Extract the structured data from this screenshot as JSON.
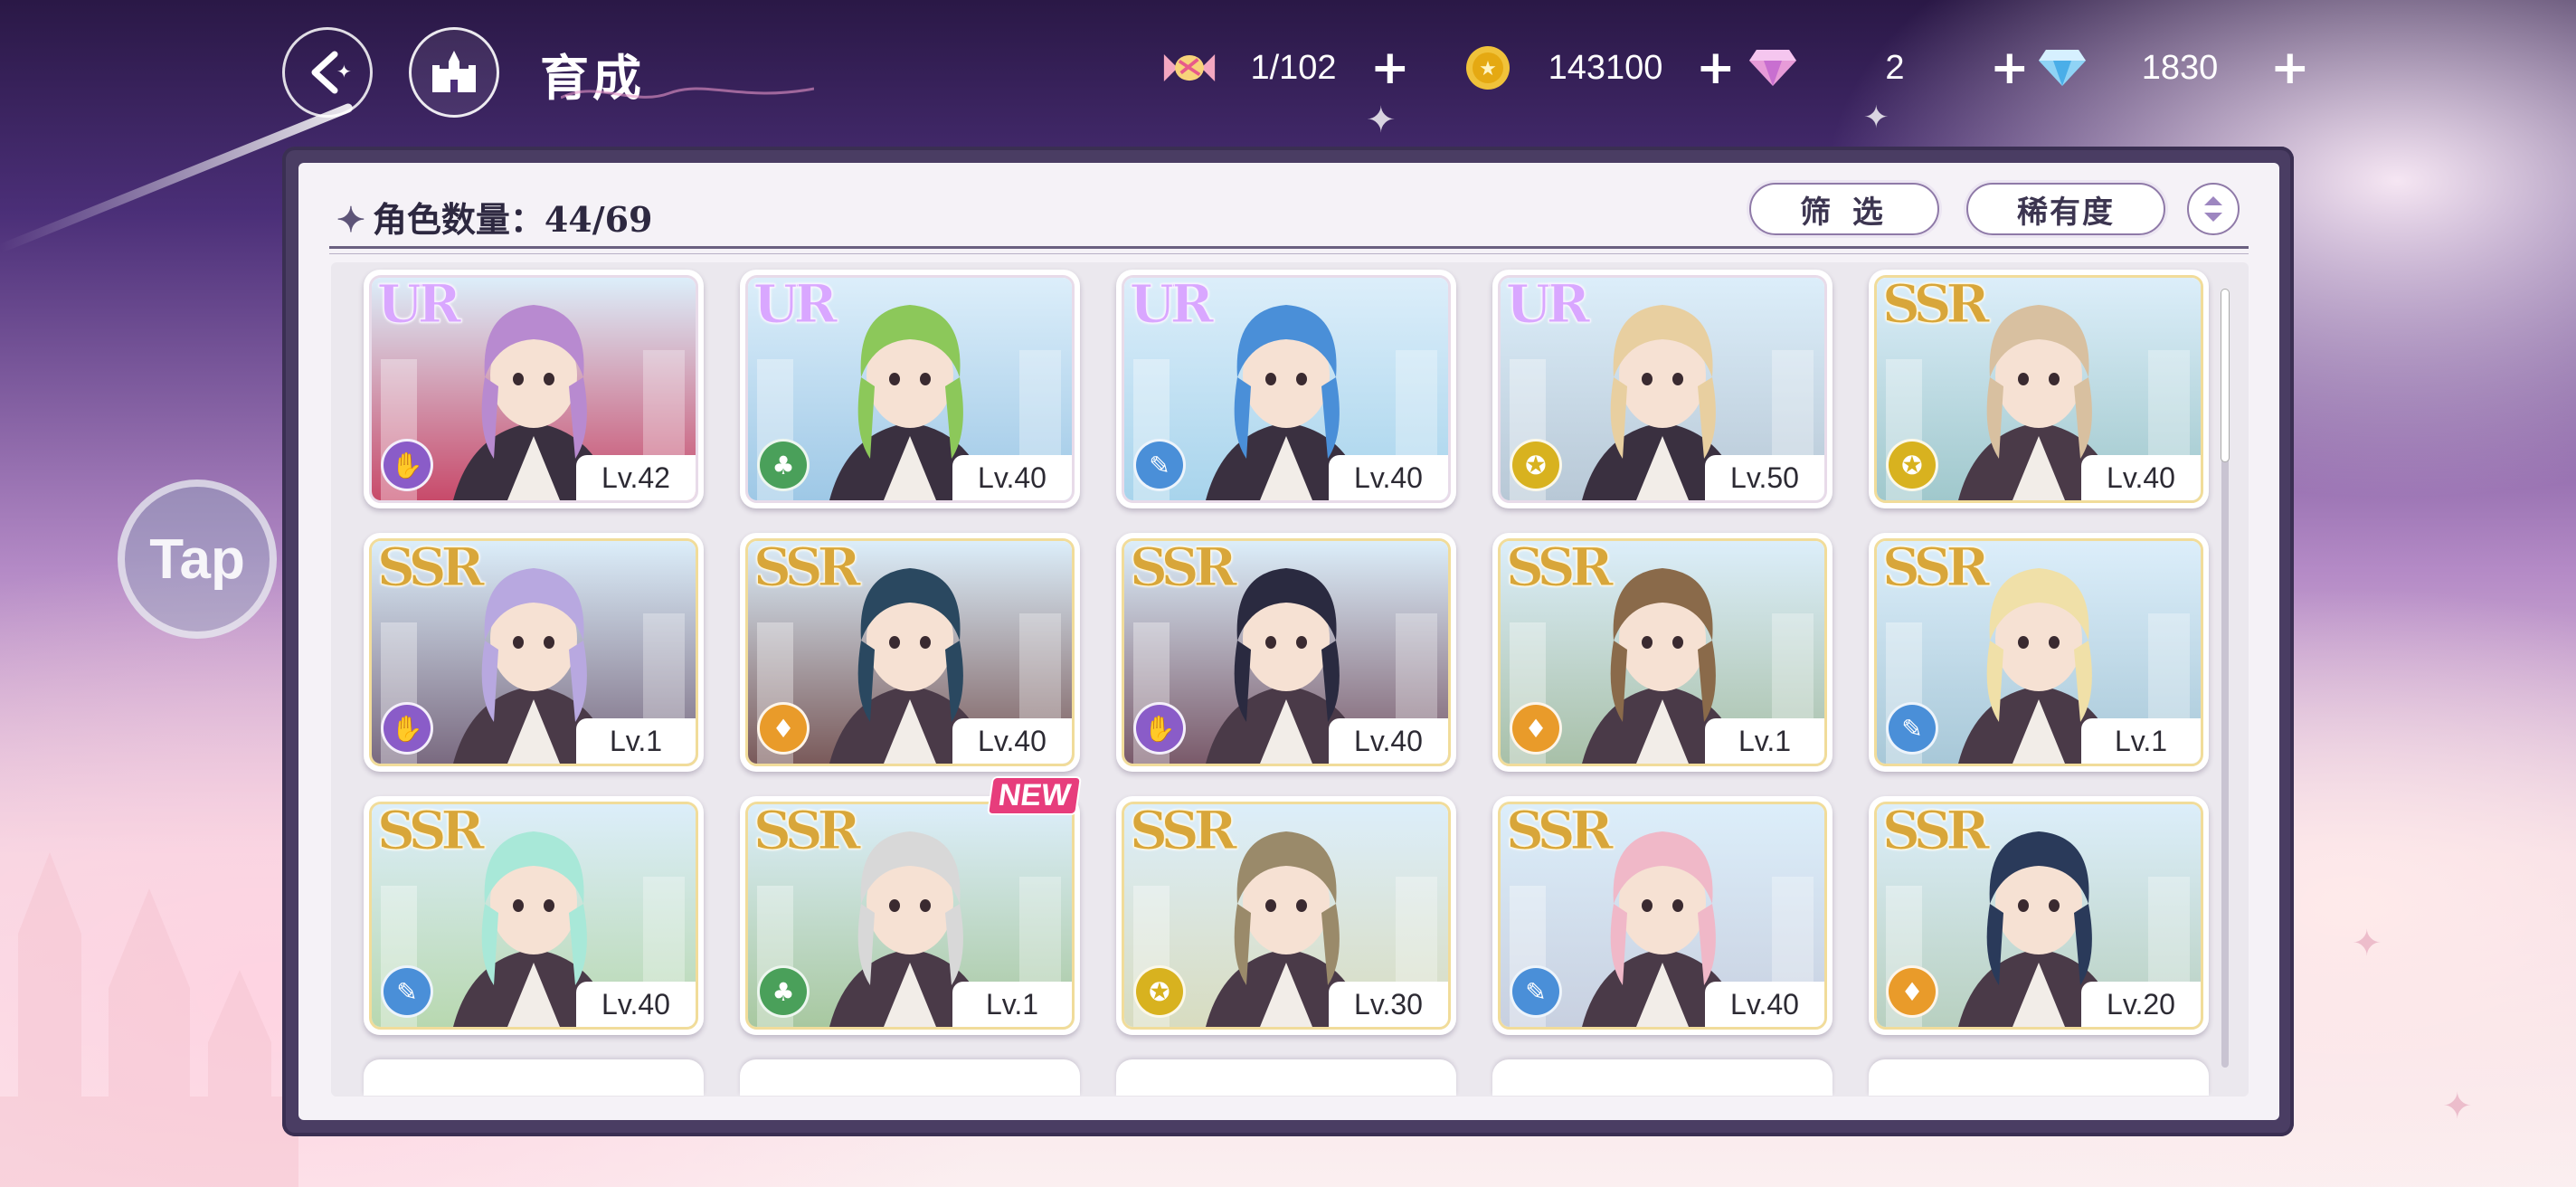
{
  "header": {
    "title": "育成",
    "resources": [
      {
        "icon": "candy-icon",
        "value": "1/102"
      },
      {
        "icon": "gold-coin-icon",
        "value": "143100"
      },
      {
        "icon": "pink-gem-icon",
        "value": "2"
      },
      {
        "icon": "blue-diamond-icon",
        "value": "1830"
      }
    ],
    "plus_symbol": "+"
  },
  "panel": {
    "count_label": "角色数量：44/69",
    "filter_label": "筛 选",
    "rarity_sort_label": "稀有度"
  },
  "tap_button": "Tap",
  "new_label": "NEW",
  "colors": {
    "ur": "#d9a7ff",
    "ssr": "#d8a63a",
    "class_purple": "#8a5cc8",
    "class_green": "#4aa05a",
    "class_blue": "#4a8fd8",
    "class_yellow": "#d8b21f",
    "class_orange": "#e99b2a"
  },
  "characters": [
    {
      "rarity": "UR",
      "level": "Lv.42",
      "class_color": "purple",
      "hair": "#b88ad0",
      "bg": "#c84a6a",
      "new": false
    },
    {
      "rarity": "UR",
      "level": "Lv.40",
      "class_color": "green",
      "hair": "#8cc85a",
      "bg": "#9ec8e6",
      "new": false
    },
    {
      "rarity": "UR",
      "level": "Lv.40",
      "class_color": "blue",
      "hair": "#4a8fd8",
      "bg": "#a8d4ec",
      "new": false
    },
    {
      "rarity": "UR",
      "level": "Lv.50",
      "class_color": "yellow",
      "hair": "#e8cfa0",
      "bg": "#b8c8d6",
      "new": false
    },
    {
      "rarity": "SSR",
      "level": "Lv.40",
      "class_color": "yellow",
      "hair": "#d8c0a0",
      "bg": "#a0c8cc",
      "new": false
    },
    {
      "rarity": "SSR",
      "level": "Lv.1",
      "class_color": "purple",
      "hair": "#b8a8e0",
      "bg": "#7a6a80",
      "new": false
    },
    {
      "rarity": "SSR",
      "level": "Lv.40",
      "class_color": "orange",
      "hair": "#2a4860",
      "bg": "#7a5a5a",
      "new": false
    },
    {
      "rarity": "SSR",
      "level": "Lv.40",
      "class_color": "purple",
      "hair": "#2a2a40",
      "bg": "#7a5a6a",
      "new": false
    },
    {
      "rarity": "SSR",
      "level": "Lv.1",
      "class_color": "orange",
      "hair": "#8a6a4a",
      "bg": "#a8c0a8",
      "new": false
    },
    {
      "rarity": "SSR",
      "level": "Lv.1",
      "class_color": "blue",
      "hair": "#f0e0a8",
      "bg": "#a8c8d8",
      "new": false
    },
    {
      "rarity": "SSR",
      "level": "Lv.40",
      "class_color": "blue",
      "hair": "#a8e8d8",
      "bg": "#b8d8b0",
      "new": false
    },
    {
      "rarity": "SSR",
      "level": "Lv.1",
      "class_color": "green",
      "hair": "#d8d8d8",
      "bg": "#a8c8a0",
      "new": true
    },
    {
      "rarity": "SSR",
      "level": "Lv.30",
      "class_color": "yellow",
      "hair": "#9a8a6a",
      "bg": "#d8dcc0",
      "new": false
    },
    {
      "rarity": "SSR",
      "level": "Lv.40",
      "class_color": "blue",
      "hair": "#f0b8c8",
      "bg": "#c8d0e0",
      "new": false
    },
    {
      "rarity": "SSR",
      "level": "Lv.20",
      "class_color": "orange",
      "hair": "#2a3a5a",
      "bg": "#b8d0c0",
      "new": false
    }
  ]
}
